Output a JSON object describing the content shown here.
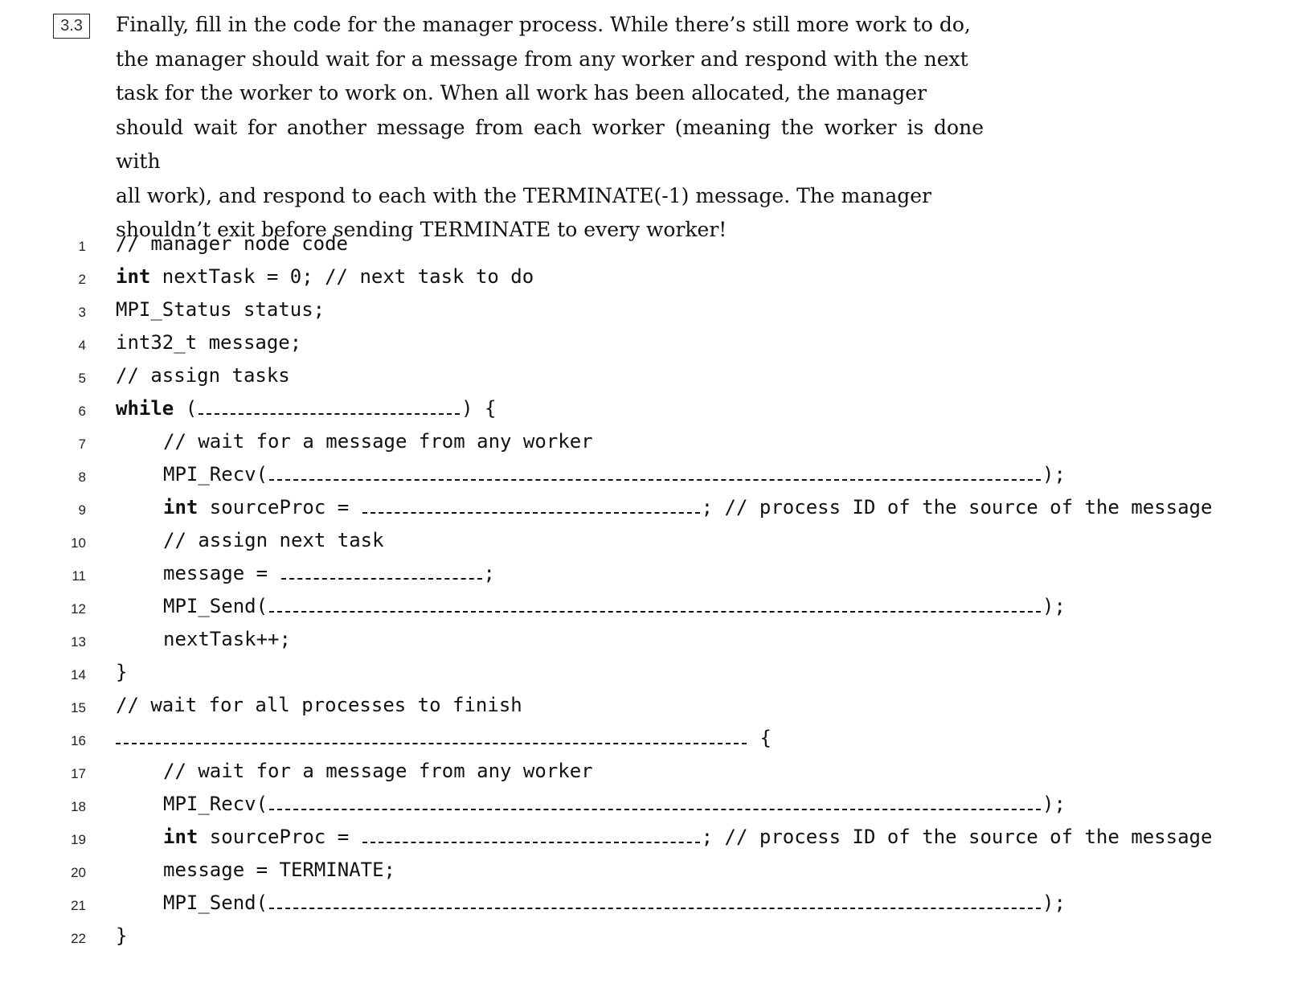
{
  "question": {
    "number": "3.3",
    "prose_lines": [
      "Finally, fill in the code for the manager process. While there’s still more work to do,",
      "the manager should wait for a message from any worker and respond with the next",
      "task for the worker to work on. When all work has been allocated, the manager",
      "should wait for another message from each worker (meaning the worker is done with",
      "all work), and respond to each with the TERMINATE(-1) message. The manager",
      "shouldn’t exit before sending TERMINATE to every worker!"
    ]
  },
  "code": {
    "line_numbers": [
      "1",
      "2",
      "3",
      "4",
      "5",
      "6",
      "7",
      "8",
      "9",
      "10",
      "11",
      "12",
      "13",
      "14",
      "15",
      "16",
      "17",
      "18",
      "19",
      "20",
      "21",
      "22"
    ],
    "l1": "// manager node code",
    "l2_kw": "int",
    "l2_rest": " nextTask = 0; // next task to do",
    "l3": "MPI_Status status;",
    "l4": "int32_t message;",
    "l5": "// assign tasks",
    "l6_kw": "while",
    "l6_open": " (",
    "l6_close": ") {",
    "l7": "// wait for a message from any worker",
    "l8_open": "MPI_Recv(",
    "l8_close": ");",
    "l9_kw": "int",
    "l9_mid": " sourceProc = ",
    "l9_close": "; // process ID of the source of the message",
    "l10": "// assign next task",
    "l11_open": "message = ",
    "l11_close": ";",
    "l12_open": "MPI_Send(",
    "l12_close": ");",
    "l13": "nextTask++;",
    "l14": "}",
    "l15": "// wait for all processes to finish",
    "l16_close": " {",
    "l17": "// wait for a message from any worker",
    "l18_open": "MPI_Recv(",
    "l18_close": ");",
    "l19_kw": "int",
    "l19_mid": " sourceProc = ",
    "l19_close": "; // process ID of the source of the message",
    "l20": "message = TERMINATE;",
    "l21_open": "MPI_Send(",
    "l21_close": ");",
    "l22": "}"
  }
}
